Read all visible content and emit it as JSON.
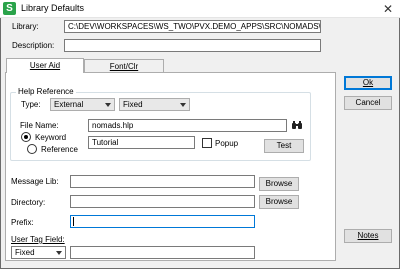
{
  "window": {
    "title": "Library Defaults",
    "app_icon_letter": "S",
    "close_glyph": "✕"
  },
  "header": {
    "library_label": "Library:",
    "library_value": "C:\\DEV\\WORKSPACES\\WS_TWO\\PVX.DEMO_APPS\\SRC\\NOMADS\\NOMADLII",
    "description_label": "Description:",
    "description_value": ""
  },
  "tabs": [
    {
      "label": "User Aid",
      "active": true
    },
    {
      "label": "Font/Clr",
      "active": false
    }
  ],
  "help_reference": {
    "group_title": "Help Reference",
    "type_label": "Type:",
    "type_value": "External",
    "type2_value": "Fixed",
    "file_name_label": "File Name:",
    "file_name_value": "nomads.hlp",
    "browse_icon": "binoculars-icon",
    "keyword_label": "Keyword",
    "reference_label": "Reference",
    "selected_mode": "Keyword",
    "keyword_value": "Tutorial",
    "popup_label": "Popup",
    "popup_checked": false,
    "test_label": "Test"
  },
  "fields": {
    "message_lib_label": "Message Lib:",
    "message_lib_value": "",
    "directory_label": "Directory:",
    "directory_value": "",
    "prefix_label": "Prefix:",
    "prefix_value": "",
    "user_tag_label": "User Tag Field:",
    "user_tag_select": "Fixed",
    "user_tag_value": "",
    "browse_label": "Browse"
  },
  "buttons": {
    "ok": "Ok",
    "cancel": "Cancel",
    "notes": "Notes"
  }
}
